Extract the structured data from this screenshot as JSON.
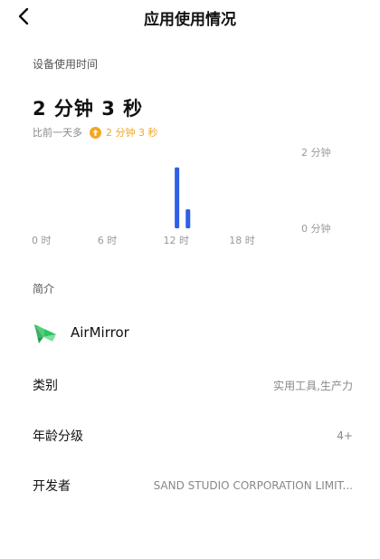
{
  "header": {
    "title": "应用使用情况"
  },
  "usage": {
    "section_label": "设备使用时间",
    "total_time": "2 分钟 3 秒",
    "compare_text": "比前一天多",
    "compare_delta": "2 分钟 3 秒",
    "up_icon": "arrow-up-circle-icon",
    "accent_color": "#f5a623"
  },
  "chart_data": {
    "type": "bar",
    "x_tick_labels": [
      "0 时",
      "6 时",
      "12 时",
      "18 时"
    ],
    "y_tick_labels": [
      "2 分钟",
      "0 分钟"
    ],
    "x_unit": "hour",
    "ylim_minutes": [
      0,
      2
    ],
    "bar_color": "#2f5fe8",
    "bars": [
      {
        "hour": 13,
        "value_minutes": 1.6
      },
      {
        "hour": 14,
        "value_minutes": 0.5
      }
    ]
  },
  "intro": {
    "section_label": "简介",
    "app_name": "AirMirror",
    "app_icon": "airmirror-logo-icon"
  },
  "details": [
    {
      "key": "类别",
      "value": "实用工具,生产力"
    },
    {
      "key": "年龄分级",
      "value": "4+"
    },
    {
      "key": "开发者",
      "value": "SAND STUDIO CORPORATION LIMIT..."
    }
  ]
}
